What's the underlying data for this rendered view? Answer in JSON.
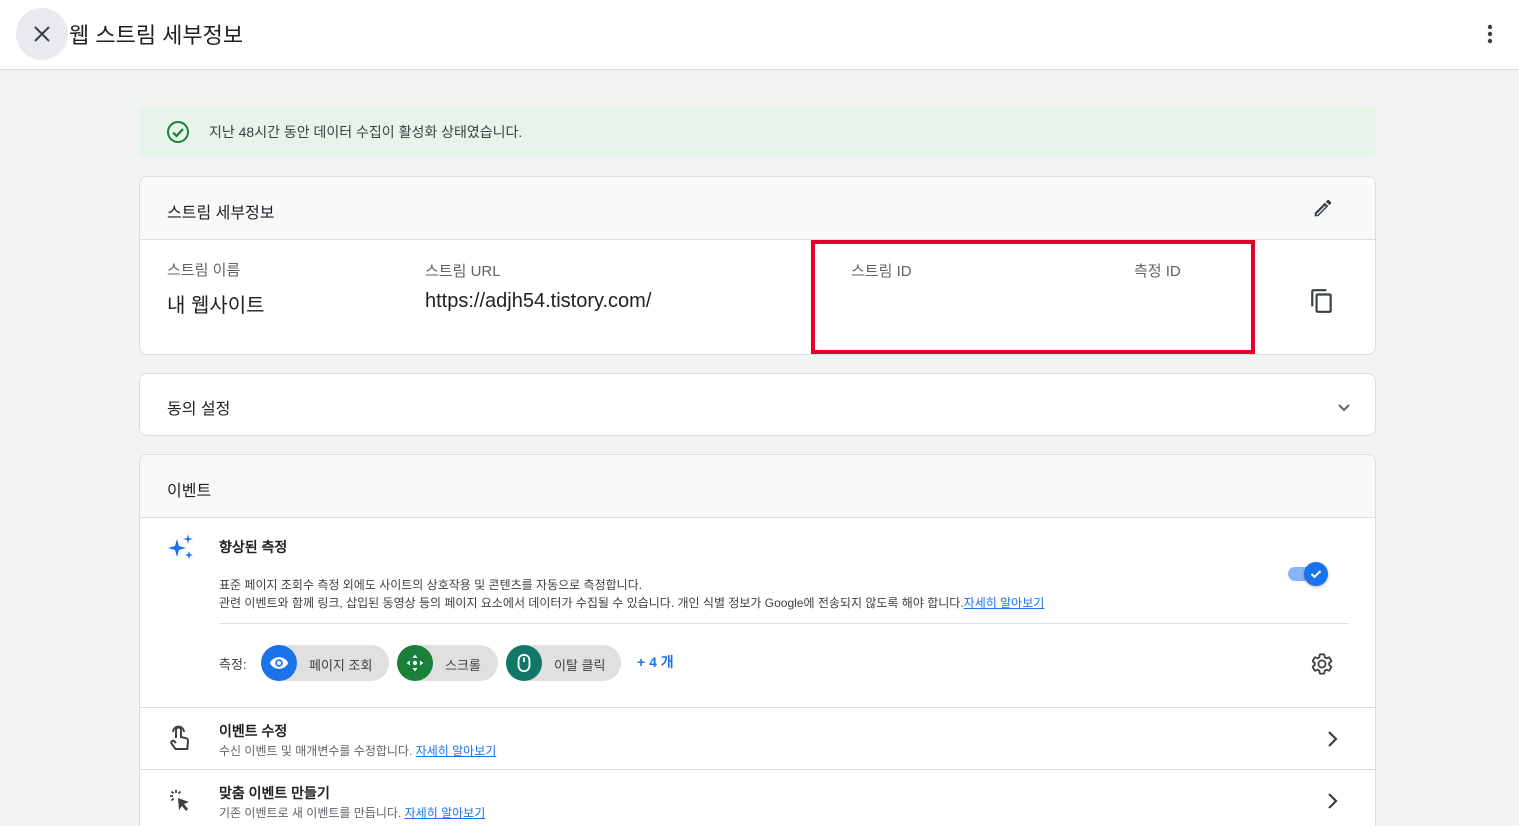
{
  "header": {
    "title": "웹 스트림 세부정보"
  },
  "banner": {
    "text": "지난 48시간 동안 데이터 수집이 활성화 상태였습니다."
  },
  "stream_details": {
    "title": "스트림 세부정보",
    "name_label": "스트림 이름",
    "name_value": "내 웹사이트",
    "url_label": "스트림 URL",
    "url_value": "https://adjh54.tistory.com/",
    "stream_id_label": "스트림 ID",
    "measurement_id_label": "측정 ID"
  },
  "consent": {
    "title": "동의 설정"
  },
  "events": {
    "title": "이벤트",
    "enhanced": {
      "title": "향상된 측정",
      "desc_line1": "표준 페이지 조회수 측정 외에도 사이트의 상호작용 및 콘텐츠를 자동으로 측정합니다.",
      "desc_line2": "관련 이벤트와 함께 링크, 삽입된 동영상 등의 페이지 요소에서 데이터가 수집될 수 있습니다. 개인 식별 정보가 Google에 전송되지 않도록 해야 합니다.",
      "learn_more": "자세히 알아보기",
      "toggle_on": true,
      "measure_label": "측정:",
      "chips": [
        {
          "label": "페이지 조회",
          "color": "#1a73e8"
        },
        {
          "label": "스크롤",
          "color": "#188038"
        },
        {
          "label": "이탈 클릭",
          "color": "#137333"
        }
      ],
      "more": "+ 4 개"
    },
    "rows": [
      {
        "title": "이벤트 수정",
        "sub": "수신 이벤트 및 매개변수를 수정합니다.",
        "link": "자세히 알아보기"
      },
      {
        "title": "맞춤 이벤트 만들기",
        "sub": "기존 이벤트로 새 이벤트를 만듭니다.",
        "link": "자세히 알아보기"
      }
    ]
  },
  "colors": {
    "accent": "#1a73e8",
    "success": "#188038",
    "highlight": "#e4002b",
    "banner_bg": "#e6f4ea"
  },
  "icons": [
    "close-icon",
    "more-vert-icon",
    "check-circle-icon",
    "edit-icon",
    "copy-icon",
    "chevron-down-icon",
    "sparkle-icon",
    "eye-icon",
    "scroll-icon",
    "mouse-icon",
    "gear-icon",
    "touch-icon",
    "click-icon",
    "chevron-right-icon"
  ]
}
